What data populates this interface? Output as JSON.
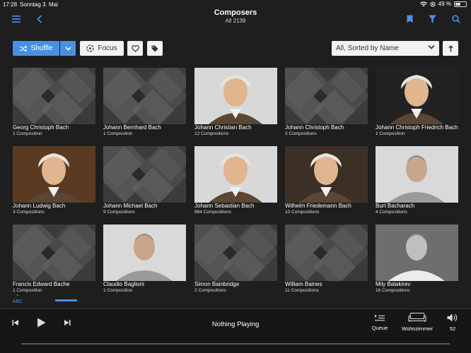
{
  "status": {
    "time": "17:28",
    "date": "Sonntag 3. Mai",
    "battery": "49 %",
    "battery_level": 0.49
  },
  "header": {
    "title": "Composers",
    "subtitle": "All 2139"
  },
  "toolbar": {
    "shuffle_label": "Shuffle",
    "focus_label": "Focus",
    "sort_value": "All, Sorted by Name"
  },
  "composers": [
    {
      "name": "Georg Christoph Bach",
      "count": "1 Composition",
      "image": "placeholder"
    },
    {
      "name": "Johann Bernhard Bach",
      "count": "1 Composition",
      "image": "placeholder"
    },
    {
      "name": "Johann Christian Bach",
      "count": "12 Compositions",
      "image": "portrait"
    },
    {
      "name": "Johann Christoph Bach",
      "count": "3 Compositions",
      "image": "placeholder"
    },
    {
      "name": "Johann Christoph Friedrich Bach",
      "count": "1 Composition",
      "image": "portrait"
    },
    {
      "name": "Johann Ludwig Bach",
      "count": "3 Compositions",
      "image": "portrait"
    },
    {
      "name": "Johann Michael Bach",
      "count": "9 Compositions",
      "image": "placeholder"
    },
    {
      "name": "Johann Sebastian Bach",
      "count": "884 Compositions",
      "image": "portrait"
    },
    {
      "name": "Wilhelm Friedemann Bach",
      "count": "10 Compositions",
      "image": "portrait"
    },
    {
      "name": "Burt Bacharach",
      "count": "4 Compositions",
      "image": "photo"
    },
    {
      "name": "Francis Edward Bache",
      "count": "1 Composition",
      "image": "placeholder"
    },
    {
      "name": "Claudio Baglioni",
      "count": "1 Composition",
      "image": "photo"
    },
    {
      "name": "Simon Bainbridge",
      "count": "2 Compositions",
      "image": "placeholder"
    },
    {
      "name": "William Baines",
      "count": "11 Compositions",
      "image": "placeholder"
    },
    {
      "name": "Mily Balakirev",
      "count": "16 Compositions",
      "image": "photo"
    }
  ],
  "index": {
    "label": "ABC"
  },
  "player": {
    "now_playing": "Nothing Playing",
    "queue_label": "Queue",
    "zone_label": "Wohnzimmer",
    "volume": "52"
  },
  "colors": {
    "accent": "#4a90e2",
    "background": "#1e1e1e"
  }
}
